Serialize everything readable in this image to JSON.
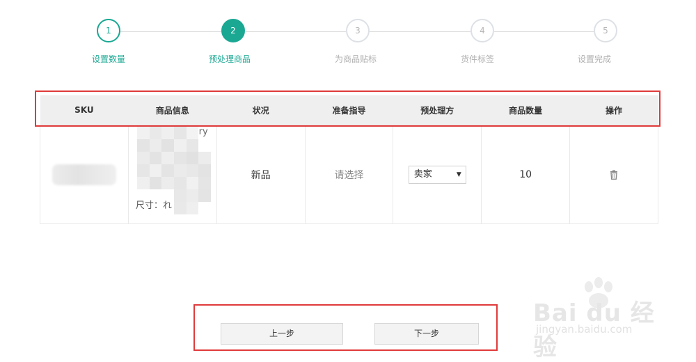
{
  "steps": [
    {
      "number": "1",
      "label": "设置数量",
      "state": "done"
    },
    {
      "number": "2",
      "label": "预处理商品",
      "state": "active"
    },
    {
      "number": "3",
      "label": "为商品贴标",
      "state": "pending"
    },
    {
      "number": "4",
      "label": "货件标签",
      "state": "pending"
    },
    {
      "number": "5",
      "label": "设置完成",
      "state": "pending"
    }
  ],
  "table": {
    "headers": [
      "SKU",
      "商品信息",
      "状况",
      "准备指导",
      "预处理方",
      "商品数量",
      "操作"
    ],
    "row": {
      "info_text_top": "ry",
      "info_size": "尺寸：れ",
      "condition": "新品",
      "prep_guide": "请选择",
      "prep_owner": "卖家",
      "quantity": "10",
      "action_icon": "trash-icon"
    }
  },
  "buttons": {
    "prev": "上一步",
    "next": "下一步"
  },
  "watermark": {
    "main": "Bai du 经验",
    "sub": "jingyan.baidu.com"
  },
  "colors": {
    "accent": "#1aa893",
    "annotation": "#e03a3a"
  }
}
